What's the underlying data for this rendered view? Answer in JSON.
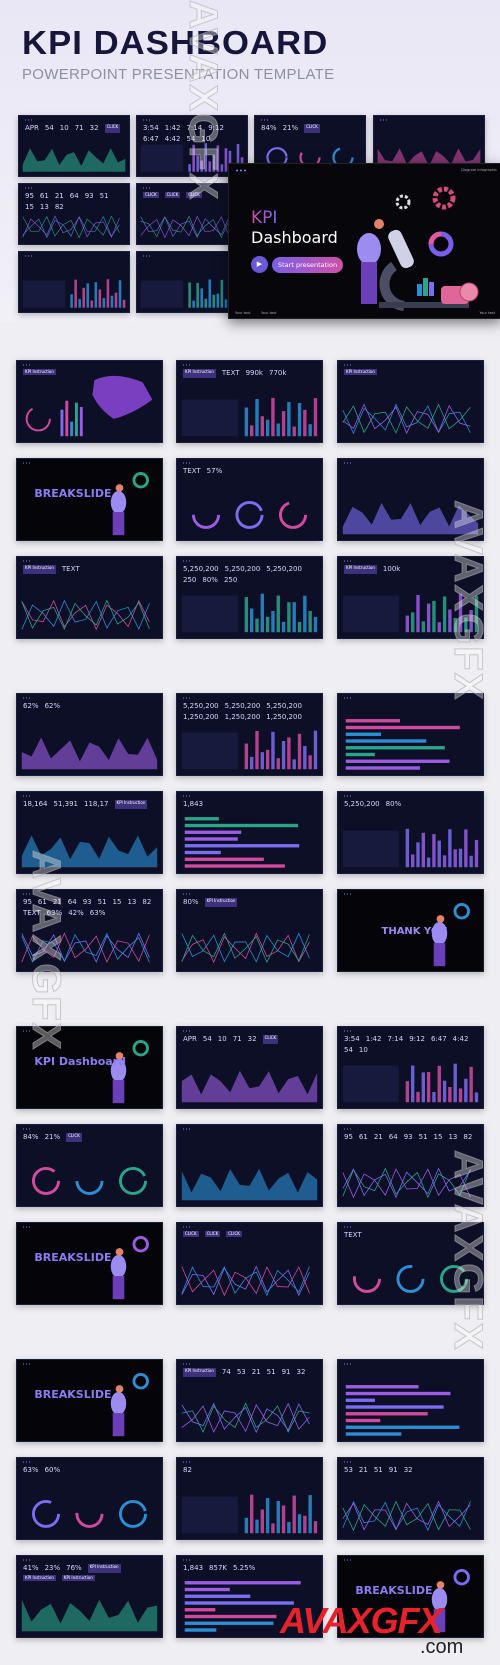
{
  "header": {
    "title": "KPI DASHBOARD",
    "subtitle": "POWERPOINT PRESENTATION TEMPLATE"
  },
  "hero": {
    "kpi": "KPI",
    "title": "Dashboard",
    "start_label": "Start presentation",
    "corner": "Diagram infographic",
    "footer": [
      "Your text",
      "Your text",
      "Your text"
    ]
  },
  "colors": {
    "slide_bg": "#0d0f26",
    "accent_purple": "#7a6df0",
    "accent_pink": "#d04ba0",
    "accent_teal": "#2aa58a",
    "accent_blue": "#2b8fd6"
  },
  "thumbnails": [
    {
      "kind": "area",
      "texts": [
        "APR",
        "54",
        "10",
        "71",
        "32",
        "CLICK"
      ]
    },
    {
      "kind": "bars",
      "texts": [
        "3:54",
        "1:42",
        "7:14",
        "9:12",
        "6:47",
        "4:42",
        "54",
        "10"
      ]
    },
    {
      "kind": "ring",
      "texts": [
        "84%",
        "21%",
        "CLICK"
      ]
    },
    {
      "kind": "area",
      "texts": []
    },
    {
      "kind": "line",
      "texts": [
        "95",
        "61",
        "21",
        "64",
        "93",
        "51",
        "15",
        "13",
        "82"
      ]
    },
    {
      "kind": "line",
      "texts": [
        "CLICK",
        "CLICK",
        "CLICK"
      ]
    },
    {
      "kind": "ring",
      "texts": [
        "TEXT"
      ]
    },
    {
      "kind": "map",
      "texts": [
        "KPI Instruction"
      ]
    },
    {
      "kind": "bars",
      "texts": []
    },
    {
      "kind": "bars",
      "texts": []
    },
    {
      "kind": "bars",
      "texts": []
    },
    {
      "kind": "bars",
      "texts": []
    }
  ],
  "groups": [
    {
      "slides": [
        {
          "kind": "map",
          "texts": [
            "KPI Instruction"
          ]
        },
        {
          "kind": "bars",
          "texts": [
            "KPI Instruction",
            "TEXT",
            "990k",
            "770k"
          ]
        },
        {
          "kind": "line",
          "texts": [
            "KPI Instruction"
          ]
        },
        {
          "kind": "person",
          "style": "break",
          "texts": [
            "BREAKSLIDE"
          ]
        },
        {
          "kind": "ring",
          "texts": [
            "TEXT",
            "57%"
          ]
        },
        {
          "kind": "area",
          "texts": []
        },
        {
          "kind": "line",
          "texts": [
            "KPI Instruction",
            "TEXT"
          ]
        },
        {
          "kind": "bars",
          "texts": [
            "5,250,200",
            "5,250,200",
            "5,250,200",
            "250",
            "80%",
            "250"
          ]
        },
        {
          "kind": "bars",
          "texts": [
            "KPI Instruction",
            "100k"
          ]
        }
      ]
    },
    {
      "slides": [
        {
          "kind": "area",
          "texts": [
            "62%",
            "62%"
          ]
        },
        {
          "kind": "bars",
          "texts": [
            "5,250,200",
            "5,250,200",
            "5,250,200",
            "1,250,200",
            "1,250,200",
            "1,250,200"
          ]
        },
        {
          "kind": "hbars",
          "texts": []
        },
        {
          "kind": "area",
          "texts": [
            "18,164",
            "51,391",
            "118,17",
            "KPI Instruction"
          ]
        },
        {
          "kind": "hbars",
          "texts": [
            "1,843"
          ]
        },
        {
          "kind": "bars",
          "texts": [
            "5,250,200",
            "80%"
          ]
        },
        {
          "kind": "line",
          "texts": [
            "95",
            "61",
            "21",
            "64",
            "93",
            "51",
            "15",
            "13",
            "82",
            "TEXT",
            "63%",
            "42%",
            "63%"
          ]
        },
        {
          "kind": "line",
          "texts": [
            "80%",
            "KPI Instruction"
          ]
        },
        {
          "kind": "person",
          "style": "thanks",
          "texts": [
            "THANK YOU"
          ]
        }
      ]
    },
    {
      "slides": [
        {
          "kind": "person",
          "style": "break",
          "texts": [
            "KPI Dashboard"
          ]
        },
        {
          "kind": "area",
          "texts": [
            "APR",
            "54",
            "10",
            "71",
            "32",
            "CLICK"
          ]
        },
        {
          "kind": "bars",
          "texts": [
            "3:54",
            "1:42",
            "7:14",
            "9:12",
            "6:47",
            "4:42",
            "54",
            "10"
          ]
        },
        {
          "kind": "ring",
          "texts": [
            "84%",
            "21%",
            "CLICK"
          ]
        },
        {
          "kind": "area",
          "texts": []
        },
        {
          "kind": "line",
          "texts": [
            "95",
            "61",
            "21",
            "64",
            "93",
            "51",
            "15",
            "13",
            "82"
          ]
        },
        {
          "kind": "person",
          "style": "break",
          "texts": [
            "BREAKSLIDE"
          ]
        },
        {
          "kind": "line",
          "texts": [
            "CLICK",
            "CLICK",
            "CLICK"
          ]
        },
        {
          "kind": "ring",
          "texts": [
            "TEXT"
          ]
        }
      ]
    },
    {
      "slides": [
        {
          "kind": "person",
          "style": "break",
          "texts": [
            "BREAKSLIDE"
          ]
        },
        {
          "kind": "line",
          "texts": [
            "KPI Instruction",
            "74",
            "53",
            "21",
            "51",
            "91",
            "32"
          ]
        },
        {
          "kind": "hbars",
          "texts": []
        },
        {
          "kind": "ring",
          "texts": [
            "63%",
            "60%"
          ]
        },
        {
          "kind": "bars",
          "texts": [
            "82"
          ]
        },
        {
          "kind": "line",
          "texts": [
            "53",
            "21",
            "51",
            "91",
            "32"
          ]
        },
        {
          "kind": "area",
          "texts": [
            "41%",
            "23%",
            "76%",
            "KPI Instruction",
            "KPI Instruction",
            "KPI Instruction"
          ]
        },
        {
          "kind": "hbars",
          "texts": [
            "1,843",
            "857K",
            "5.25%"
          ]
        },
        {
          "kind": "person",
          "style": "break",
          "texts": [
            "BREAKSLIDE"
          ]
        }
      ]
    }
  ],
  "watermark": {
    "text": "AVAXGFX",
    "logo": "AVAXGFX",
    ".com": ".com"
  }
}
